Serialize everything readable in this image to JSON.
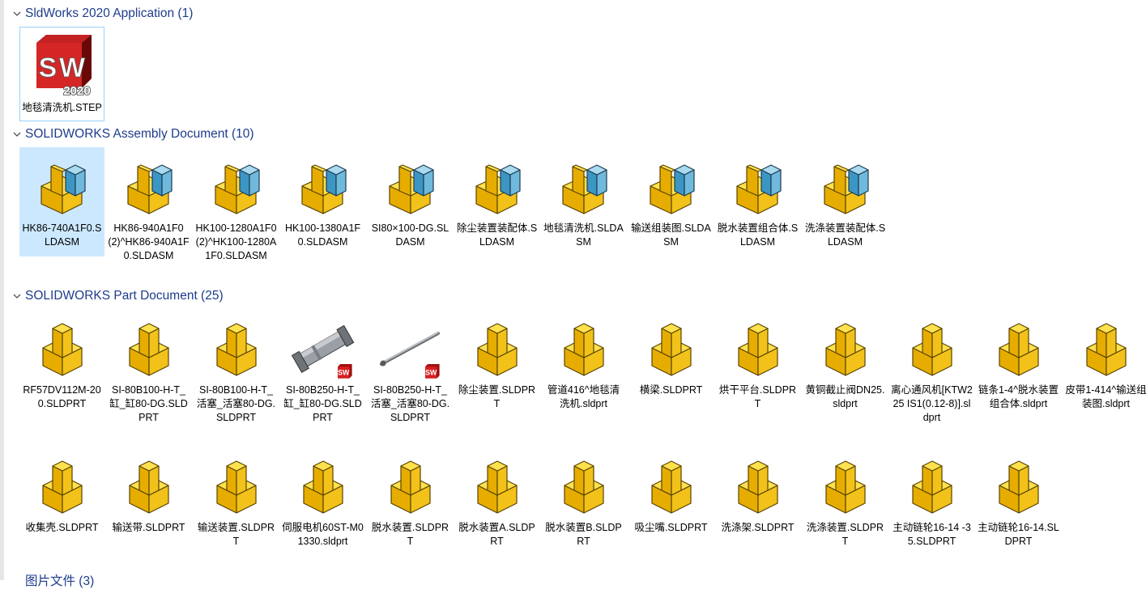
{
  "colors": {
    "group_title": "#1e3c8c",
    "selection": "#cce8ff",
    "part_yellow": "#f5cc1e",
    "assembly_blue": "#7ec8e8"
  },
  "groups": [
    {
      "id": "application",
      "title": "SldWorks 2020 Application (1)",
      "items": [
        {
          "icon": "solidworks-2020-app-icon",
          "label": "地毯清洗机.STEP"
        }
      ]
    },
    {
      "id": "assembly",
      "title": "SOLIDWORKS Assembly Document (10)",
      "items": [
        {
          "icon": "assembly-icon",
          "label": "HK86-740A1F0.SLDASM"
        },
        {
          "icon": "assembly-icon",
          "label": "HK86-940A1F0(2)^HK86-940A1F0.SLDASM"
        },
        {
          "icon": "assembly-icon",
          "label": "HK100-1280A1F0(2)^HK100-1280A1F0.SLDASM"
        },
        {
          "icon": "assembly-icon",
          "label": "HK100-1380A1F0.SLDASM"
        },
        {
          "icon": "assembly-icon",
          "label": "SI80×100-DG.SLDASM"
        },
        {
          "icon": "assembly-icon",
          "label": "除尘装置装配体.SLDASM"
        },
        {
          "icon": "assembly-icon",
          "label": "地毯清洗机.SLDASM"
        },
        {
          "icon": "assembly-icon",
          "label": "输送组装图.SLDASM"
        },
        {
          "icon": "assembly-icon",
          "label": "脱水装置组合体.SLDASM"
        },
        {
          "icon": "assembly-icon",
          "label": "洗涤装置装配体.SLDASM"
        }
      ]
    },
    {
      "id": "part",
      "title": "SOLIDWORKS Part Document (25)",
      "items": [
        {
          "icon": "part-icon",
          "label": "RF57DV112M-200.SLDPRT"
        },
        {
          "icon": "part-icon",
          "label": "SI-80B100-H-T_缸_缸80-DG.SLDPRT"
        },
        {
          "icon": "part-icon",
          "label": "SI-80B100-H-T_活塞_活塞80-DG.SLDPRT"
        },
        {
          "icon": "cylinder-thumbnail-icon",
          "label": "SI-80B250-H-T_缸_缸80-DG.SLDPRT"
        },
        {
          "icon": "piston-rod-thumbnail-icon",
          "label": "SI-80B250-H-T_活塞_活塞80-DG.SLDPRT"
        },
        {
          "icon": "part-icon",
          "label": "除尘装置.SLDPRT"
        },
        {
          "icon": "part-icon",
          "label": "管道416^地毯清洗机.sldprt"
        },
        {
          "icon": "part-icon",
          "label": "横梁.SLDPRT"
        },
        {
          "icon": "part-icon",
          "label": "烘干平台.SLDPRT"
        },
        {
          "icon": "part-icon",
          "label": "黄铜截止阀DN25.sldprt"
        },
        {
          "icon": "part-icon",
          "label": "离心通风机[KTW225 IS1(0.12-8)].sldprt"
        },
        {
          "icon": "part-icon",
          "label": "链条1-4^脱水装置组合体.sldprt"
        },
        {
          "icon": "part-icon",
          "label": "皮带1-414^输送组装图.sldprt"
        },
        {
          "icon": "part-icon",
          "label": "收集壳.SLDPRT"
        },
        {
          "icon": "part-icon",
          "label": "输送带.SLDPRT"
        },
        {
          "icon": "part-icon",
          "label": "输送装置.SLDPRT"
        },
        {
          "icon": "part-icon",
          "label": "伺服电机60ST-M01330.sldprt"
        },
        {
          "icon": "part-icon",
          "label": "脱水装置.SLDPRT"
        },
        {
          "icon": "part-icon",
          "label": "脱水装置A.SLDPRT"
        },
        {
          "icon": "part-icon",
          "label": "脱水装置B.SLDPRT"
        },
        {
          "icon": "part-icon",
          "label": "吸尘嘴.SLDPRT"
        },
        {
          "icon": "part-icon",
          "label": "洗涤架.SLDPRT"
        },
        {
          "icon": "part-icon",
          "label": "洗涤装置.SLDPRT"
        },
        {
          "icon": "part-icon",
          "label": "主动链轮16-14 -35.SLDPRT"
        },
        {
          "icon": "part-icon",
          "label": "主动链轮16-14.SLDPRT"
        }
      ]
    },
    {
      "id": "images",
      "title": "图片文件 (3)",
      "items": []
    }
  ]
}
